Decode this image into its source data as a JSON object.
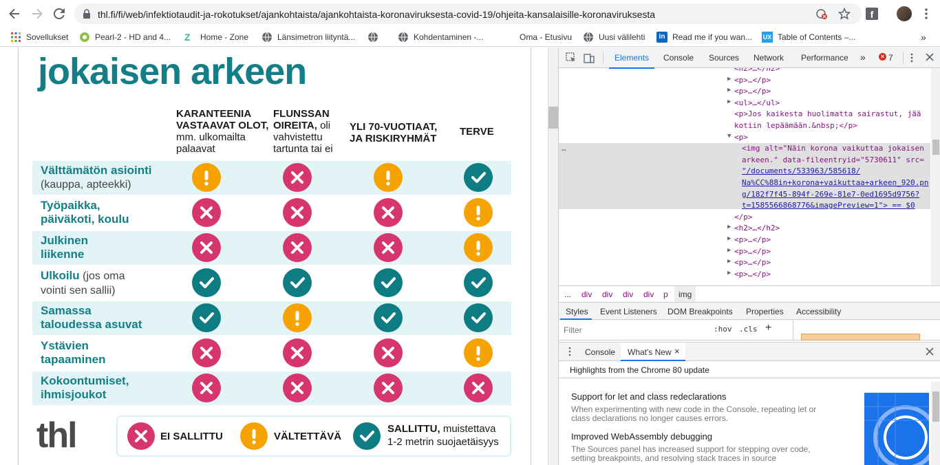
{
  "browser": {
    "url": "thl.fi/fi/web/infektiotaudit-ja-rokotukset/ajankohtaista/ajankohtaista-koronaviruksesta-covid-19/ohjeita-kansalaisille-koronaviruksesta",
    "bookmarks": [
      {
        "label": "Sovellukset",
        "icon": "apps-grid-icon"
      },
      {
        "label": "Pearl-2 - HD and 4...",
        "icon": "pearl-icon"
      },
      {
        "label": "Home - Zone",
        "icon": "zone-icon"
      },
      {
        "label": "Länsimetron liityntä...",
        "icon": "globe-icon"
      },
      {
        "label": "",
        "icon": "globe-icon"
      },
      {
        "label": "Kohdentaminen -...",
        "icon": "globe-icon"
      },
      {
        "label": "Oma - Etusivu",
        "icon": "none"
      },
      {
        "label": "Uusi välilehti",
        "icon": "globe-icon"
      },
      {
        "label": "Read me if you wan...",
        "icon": "linkedin-icon"
      },
      {
        "label": "Table of Contents –...",
        "icon": "ux-icon"
      }
    ],
    "bookmarks_more": "»"
  },
  "infographic": {
    "title": "jokaisen arkeen",
    "columns": [
      {
        "bold": "KARANTEENIA VASTAAVAT OLOT,",
        "rest": "mm. ulkomailta palaavat"
      },
      {
        "bold": "FLUNSSAN OIREITA,",
        "rest": "oli vahvistettu tartunta tai ei"
      },
      {
        "bold": "YLI 70-VUOTIAAT, JA RISKIRYHMÄT",
        "rest": ""
      },
      {
        "bold": "TERVE",
        "rest": ""
      }
    ],
    "rows": [
      {
        "label": "Välttämätön asiointi",
        "sub": "(kauppa, apteekki)",
        "cells": [
          "ex",
          "x",
          "ex",
          "ok"
        ]
      },
      {
        "label": "Työpaikka,\npäiväkoti, koulu",
        "sub": "",
        "cells": [
          "x",
          "x",
          "x",
          "ex"
        ]
      },
      {
        "label": "Julkinen\nliikenne",
        "sub": "",
        "cells": [
          "x",
          "x",
          "x",
          "ex"
        ]
      },
      {
        "label": "Ulkoilu",
        "sub": " (jos oma\nvointi sen sallii)",
        "cells": [
          "ok",
          "ok",
          "ok",
          "ok"
        ]
      },
      {
        "label": "Samassa\ntaloudessa asuvat",
        "sub": "",
        "cells": [
          "ok",
          "ex",
          "ok",
          "ok"
        ]
      },
      {
        "label": "Ystävien\ntapaaminen",
        "sub": "",
        "cells": [
          "x",
          "x",
          "x",
          "ex"
        ]
      },
      {
        "label": "Kokoontumiset,\nihmisjoukot",
        "sub": "",
        "cells": [
          "x",
          "x",
          "x",
          "x"
        ]
      }
    ],
    "logo": "thl",
    "legend": {
      "not_allowed": "EI SALLITTU",
      "avoid": "VÄLTETTÄVÄ",
      "allowed_bold": "SALLITTU,",
      "allowed_rest": " muistettava",
      "allowed_line2": "1-2 metrin suojaetäisyys"
    }
  },
  "devtools": {
    "tabs": [
      "Elements",
      "Console",
      "Sources",
      "Network",
      "Performance"
    ],
    "error_count": "7",
    "lines": [
      {
        "indent": 255,
        "arrow": "",
        "html": "<h2>…</h2>"
      },
      {
        "indent": 255,
        "arrow": "▶",
        "html": "<p>…</p>"
      },
      {
        "indent": 255,
        "arrow": "▶",
        "html": "<p>…</p>"
      },
      {
        "indent": 255,
        "arrow": "▶",
        "html": "<ul>…</ul>"
      },
      {
        "indent": 255,
        "arrow": "",
        "html": "<p>Jos kaikesta huolimatta sairastut, jää"
      },
      {
        "indent": 255,
        "arrow": "",
        "html": "kotiin lepäämään.&nbsp;</p>"
      },
      {
        "indent": 255,
        "arrow": "▼",
        "html": "<p>"
      },
      {
        "indent": 266,
        "arrow": "",
        "html": "<img alt=\"Näin korona vaikuttaa jokaisen"
      },
      {
        "indent": 266,
        "arrow": "",
        "html": "arkeen.\" data-fileentryid=\"5730611\" src="
      },
      {
        "indent": 266,
        "arrow": "",
        "html": "\"/documents/533963/585618/"
      },
      {
        "indent": 266,
        "arrow": "",
        "html": "Na%CC%88in+korona+vaikuttaa+arkeen_920.pn"
      },
      {
        "indent": 266,
        "arrow": "",
        "html": "g/182f7f45-894f-269e-81e7-0ed1695d9756?"
      },
      {
        "indent": 266,
        "arrow": "",
        "html": "t=1585566868776&imagePreview=1\"> == $0"
      },
      {
        "indent": 255,
        "arrow": "",
        "html": "</p>"
      },
      {
        "indent": 255,
        "arrow": "▶",
        "html": "<h2>…</h2>"
      },
      {
        "indent": 255,
        "arrow": "▶",
        "html": "<p>…</p>"
      },
      {
        "indent": 255,
        "arrow": "▶",
        "html": "<p>…</p>"
      },
      {
        "indent": 255,
        "arrow": "▶",
        "html": "<p>…</p>"
      },
      {
        "indent": 255,
        "arrow": "▶",
        "html": "<p>…</p>"
      }
    ],
    "breadcrumb": [
      "...",
      "div",
      "div",
      "div",
      "div",
      "p",
      "img"
    ],
    "styles_tabs": [
      "Styles",
      "Event Listeners",
      "DOM Breakpoints",
      "Properties",
      "Accessibility"
    ],
    "filter_placeholder": "Filter",
    "hov": ":hov",
    "cls": ".cls",
    "drawer_tabs": [
      "Console",
      "What's New"
    ],
    "highlights": "Highlights from the Chrome 80 update",
    "news": [
      {
        "title": "Support for let and class redeclarations",
        "text": "When experimenting with new code in the Console, repeating let or class declarations no longer causes errors."
      },
      {
        "title": "Improved WebAssembly debugging",
        "text": "The Sources panel has increased support for stepping over code, setting breakpoints, and resolving stack traces in source"
      }
    ]
  }
}
